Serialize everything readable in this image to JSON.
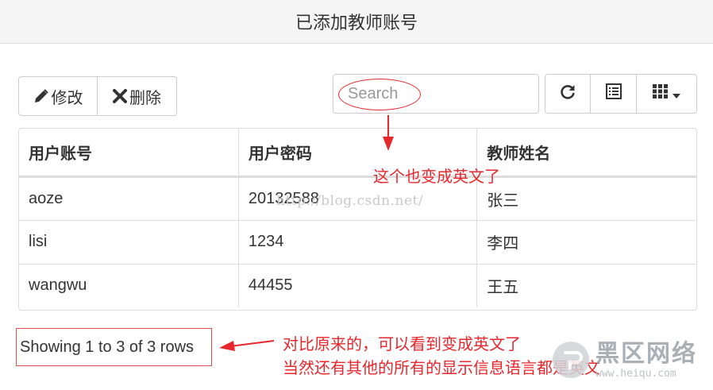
{
  "header": {
    "title": "已添加教师账号"
  },
  "toolbar": {
    "edit_label": "修改",
    "delete_label": "删除",
    "search_placeholder": "Search",
    "icons": {
      "edit": "pencil-icon",
      "delete": "x-icon",
      "refresh": "refresh-icon",
      "toggle": "list-icon",
      "columns": "grid-icon"
    }
  },
  "table": {
    "columns": [
      "用户账号",
      "用户密码",
      "教师姓名"
    ],
    "rows": [
      [
        "aoze",
        "20132588",
        "张三"
      ],
      [
        "lisi",
        "1234",
        "李四"
      ],
      [
        "wangwu",
        "44455",
        "王五"
      ]
    ]
  },
  "pagination": {
    "info": "Showing 1 to 3 of 3 rows"
  },
  "annotations": {
    "search_note": "这个也变成英文了",
    "bottom_note_line1": "对比原来的，可以看到变成英文了",
    "bottom_note_line2": "当然还有其他的所有的显示信息语言都是英文"
  },
  "watermark": {
    "url": "http://blog.csdn.net/",
    "site_name": "黑区网络",
    "site_url": "www.heiqu.com"
  },
  "colors": {
    "annotation": "#e8272d",
    "border": "#dddddd",
    "header_bg": "#f5f5f5"
  }
}
